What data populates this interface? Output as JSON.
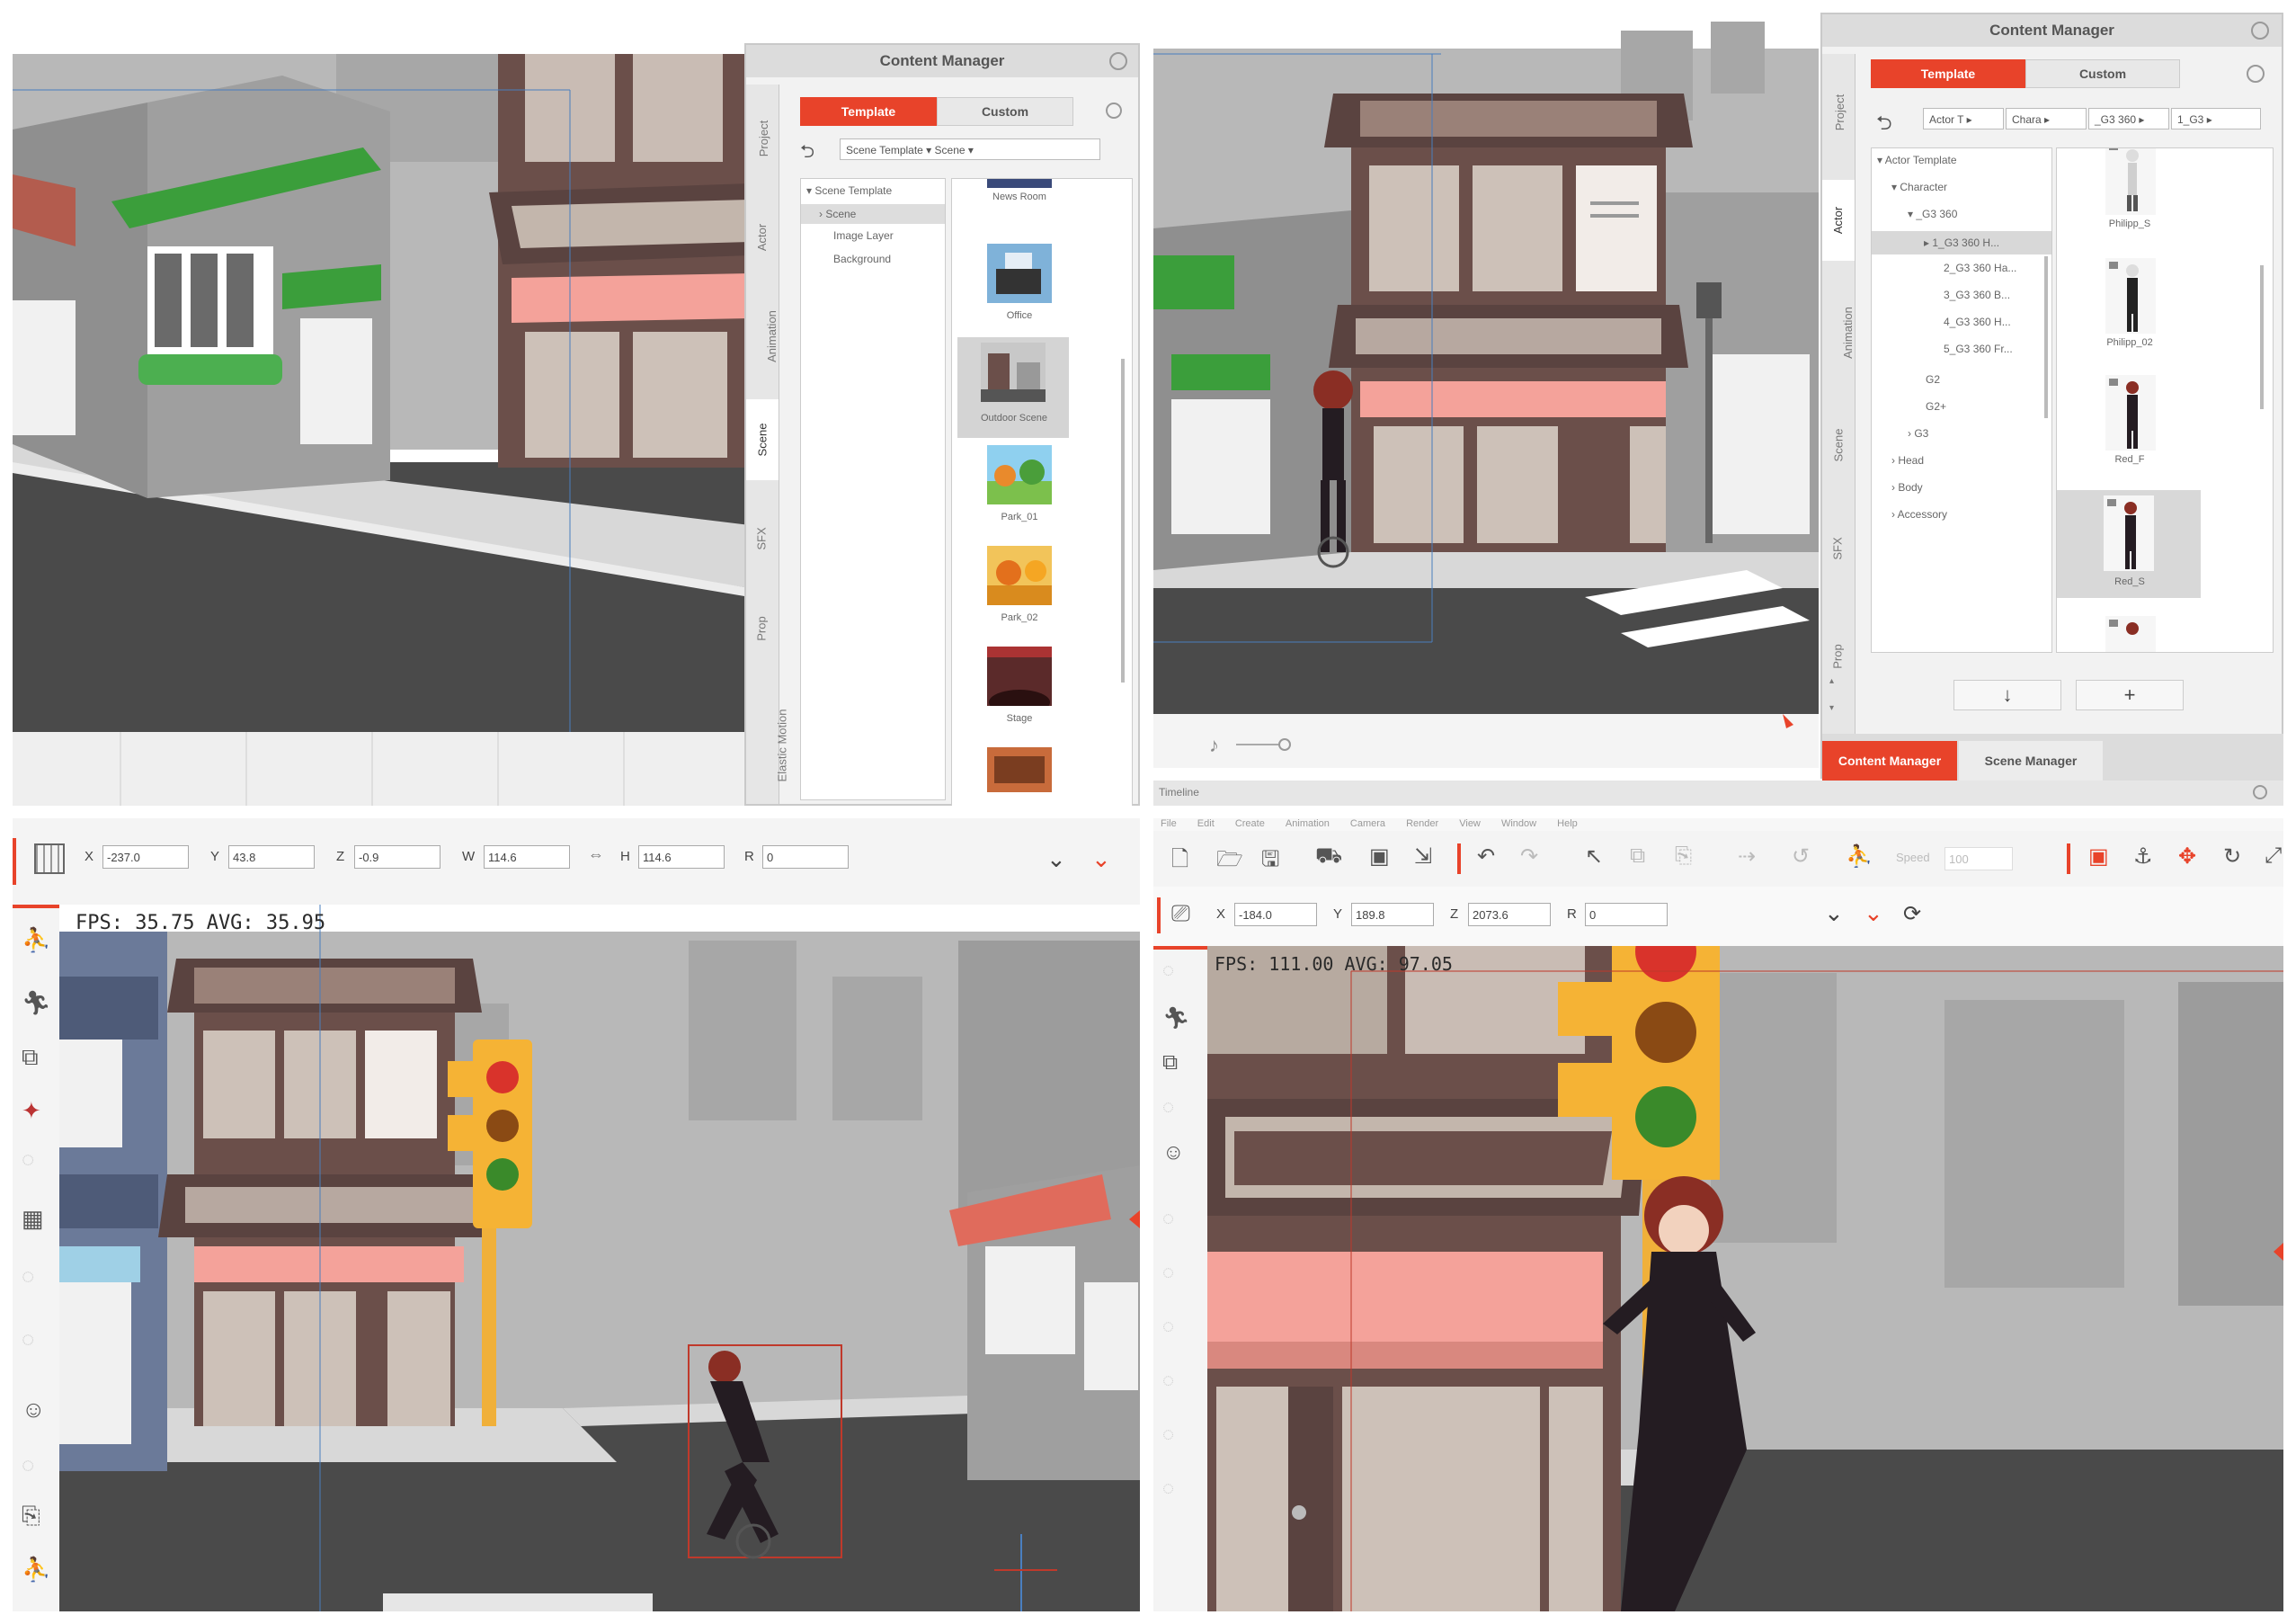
{
  "quadrant_tl": {
    "content_manager": {
      "title": "Content Manager",
      "tabs": [
        "Template",
        "Custom"
      ],
      "side_tabs": [
        "Project",
        "Actor",
        "Animation",
        "Scene",
        "SFX",
        "Prop",
        "Elastic Motion"
      ],
      "path_combo": "Scene Template ▾  Scene ▾",
      "tree": [
        "▾  Scene Template",
        "  › Scene",
        "Image Layer",
        "Background"
      ],
      "thumbnails": [
        "News Room",
        "Office",
        "Outdoor Scene",
        "Park_01",
        "Park_02",
        "Stage"
      ]
    }
  },
  "quadrant_tr": {
    "content_manager": {
      "title": "Content Manager",
      "tabs": [
        "Template",
        "Custom"
      ],
      "side_tabs": [
        "Project",
        "Actor",
        "Animation",
        "Scene",
        "SFX",
        "Prop"
      ],
      "path_combo": [
        "Actor T ▸",
        "Chara ▸",
        "_G3 360 ▸",
        "1_G3 ▸"
      ],
      "tree": [
        "▾ Actor Template",
        "▾ Character",
        "▾ _G3 360",
        "▸ 1_G3 360 H...",
        "2_G3 360 Ha...",
        "3_G3 360 B...",
        "4_G3 360 H...",
        "5_G3 360 Fr...",
        "G2",
        "G2+",
        "› G3",
        "› Head",
        "› Body",
        "› Accessory"
      ],
      "thumbnails": [
        "Philipp_S",
        "Philipp_02",
        "Red_F",
        "Red_S"
      ],
      "bottom_buttons": [
        "↓",
        "+"
      ],
      "bottom_tabs": [
        "Content Manager",
        "Scene Manager"
      ]
    },
    "status_label": "Timeline"
  },
  "quadrant_bl": {
    "toolbar": {
      "fields": [
        {
          "label": "X",
          "value": "-237.0"
        },
        {
          "label": "Y",
          "value": "43.8"
        },
        {
          "label": "Z",
          "value": "-0.9"
        },
        {
          "label": "W",
          "value": "114.6"
        },
        {
          "label": "H",
          "value": "114.6"
        },
        {
          "label": "R",
          "value": "0"
        }
      ]
    },
    "fps_text": "FPS: 35.75 AVG: 35.95"
  },
  "quadrant_br": {
    "menu": [
      "File",
      "Edit",
      "Create",
      "Animation",
      "Camera",
      "Render",
      "View",
      "Window",
      "Help"
    ],
    "toolbar": {
      "fields": [
        {
          "label": "X",
          "value": "-184.0"
        },
        {
          "label": "Y",
          "value": "189.8"
        },
        {
          "label": "Z",
          "value": "2073.6"
        },
        {
          "label": "R",
          "value": "0"
        }
      ],
      "speed_label": "Speed",
      "speed_value": "100"
    },
    "fps_text": "FPS: 111.00 AVG: 97.05"
  },
  "colors": {
    "accent": "#e8432a",
    "building_brown": "#6b4f4a",
    "awning_pink": "#f4a29a",
    "awning_green": "#3b9e3b",
    "sky": "#ffffff",
    "skyline": "#b8b8b8",
    "road": "#4a4a4a",
    "sidewalk": "#d8d8d8"
  }
}
